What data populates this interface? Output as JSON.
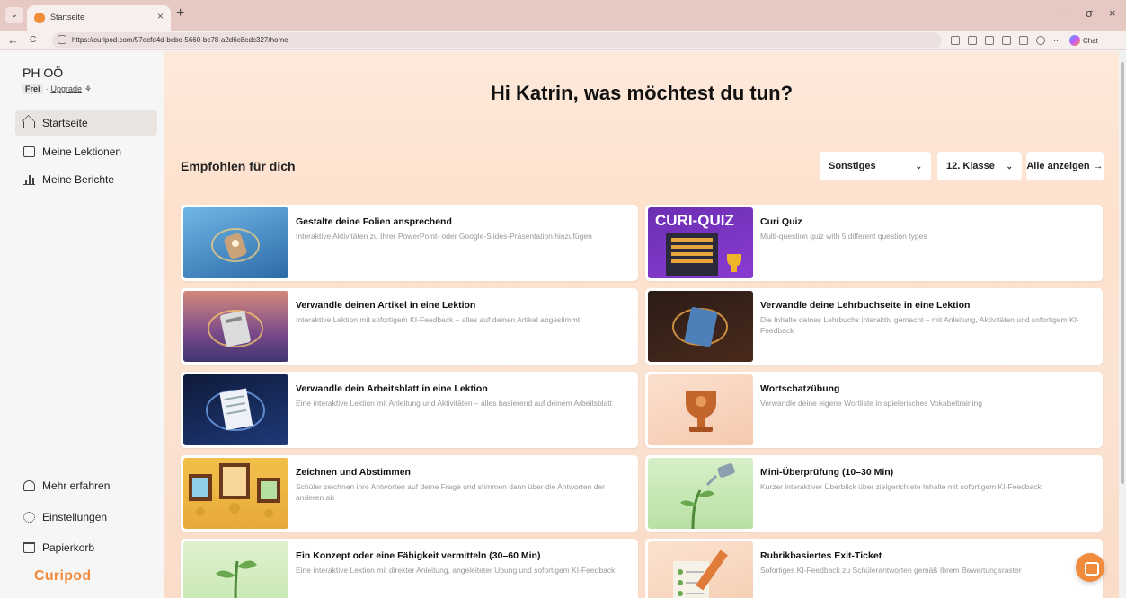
{
  "browser": {
    "tab_title": "Startseite",
    "tab_close": "×",
    "new_tab": "+",
    "menu_icon": "chevron-down-icon",
    "back": "←",
    "reload": "C",
    "url": "https://curipod.com/57ecfd4d-bcbe-5660-bc78-a2d6c8edc327/home",
    "chat_label": "Chat",
    "more": "···",
    "minimize": "−",
    "restore": "σ",
    "close": "×"
  },
  "sidebar": {
    "workspace": "PH OÖ",
    "plan_badge": "Frei",
    "plan_separator": "·",
    "upgrade": "Upgrade",
    "upgrade_icon": "⚘",
    "nav": [
      {
        "label": "Startseite",
        "icon": "home-icon"
      },
      {
        "label": "Meine Lektionen",
        "icon": "folder-icon"
      },
      {
        "label": "Meine Berichte",
        "icon": "bar-chart-icon"
      }
    ],
    "footer": [
      {
        "label": "Mehr erfahren",
        "icon": "graduation-cap-icon"
      },
      {
        "label": "Einstellungen",
        "icon": "gear-icon"
      },
      {
        "label": "Papierkorb",
        "icon": "trash-icon"
      }
    ],
    "logo": "Curipod"
  },
  "main": {
    "greeting": "Hi Katrin, was möchtest du tun?",
    "section_title": "Empfohlen für dich",
    "filter_subject": "Sonstiges",
    "filter_grade": "12. Klasse",
    "show_all": "Alle anzeigen",
    "chevron": "⌄",
    "arrow": "→",
    "cards": [
      {
        "title": "Gestalte deine Folien ansprechend",
        "desc": "Interaktive Aktivitäten zu Ihrer PowerPoint- oder Google-Slides-Präsentation hinzufügen"
      },
      {
        "title": "Curi Quiz",
        "desc": "Multi-question quiz with 5 different question types",
        "thumb_text": "CURI-QUIZ"
      },
      {
        "title": "Verwandle deinen Artikel in eine Lektion",
        "desc": "Interaktive Lektion mit sofortigem KI-Feedback – alles auf deinen Artikel abgestimmt"
      },
      {
        "title": "Verwandle deine Lehrbuchseite in eine Lektion",
        "desc": "Die Inhalte deines Lehrbuchs interaktiv gemacht – mit Anleitung, Aktivitäten und sofortigem KI-Feedback"
      },
      {
        "title": "Verwandle dein Arbeitsblatt in eine Lektion",
        "desc": "Eine interaktive Lektion mit Anleitung und Aktivitäten – alles basierend auf deinem Arbeitsblatt"
      },
      {
        "title": "Wortschatzübung",
        "desc": "Verwandle deine eigene Wortliste in spielerisches Vokabeltraining"
      },
      {
        "title": "Zeichnen und Abstimmen",
        "desc": "Schüler zeichnen ihre Antworten auf deine Frage und stimmen dann über die Antworten der anderen ab"
      },
      {
        "title": "Mini-Überprüfung (10–30 Min)",
        "desc": "Kurzer interaktiver Überblick über zielgerichtete Inhalte mit sofortigem KI-Feedback"
      },
      {
        "title": "Ein Konzept oder eine Fähigkeit vermitteln (30–60 Min)",
        "desc": "Eine interaktive Lektion mit direkter Anleitung, angeleiteter Übung und sofortigem KI-Feedback"
      },
      {
        "title": "Rubrikbasiertes Exit-Ticket",
        "desc": "Sofortiges KI-Feedback zu Schülerantworten gemäß Ihrem Bewertungsraster"
      }
    ]
  },
  "colors": {
    "accent": "#f08a3c",
    "tabbar": "#e7c9c4"
  }
}
